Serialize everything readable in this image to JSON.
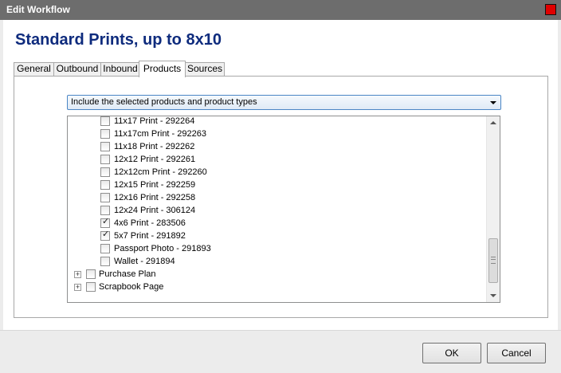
{
  "window": {
    "title": "Edit Workflow"
  },
  "heading": "Standard Prints, up to 8x10",
  "tabs": [
    {
      "label": "General"
    },
    {
      "label": "Outbound"
    },
    {
      "label": "Inbound"
    },
    {
      "label": "Products",
      "active": true
    },
    {
      "label": "Sources"
    }
  ],
  "filter_combo": {
    "value": "Include the selected products and product types"
  },
  "product_tree": {
    "items": [
      {
        "label": "11x17 Print - 292264",
        "checked": false
      },
      {
        "label": "11x17cm Print - 292263",
        "checked": false
      },
      {
        "label": "11x18 Print - 292262",
        "checked": false
      },
      {
        "label": "12x12 Print - 292261",
        "checked": false
      },
      {
        "label": "12x12cm Print - 292260",
        "checked": false
      },
      {
        "label": "12x15 Print - 292259",
        "checked": false
      },
      {
        "label": "12x16 Print - 292258",
        "checked": false
      },
      {
        "label": "12x24 Print - 306124",
        "checked": false
      },
      {
        "label": "4x6 Print - 283506",
        "checked": true
      },
      {
        "label": "5x7 Print - 291892",
        "checked": true
      },
      {
        "label": "Passport Photo - 291893",
        "checked": false
      },
      {
        "label": "Wallet - 291894",
        "checked": false
      }
    ],
    "groups": [
      {
        "label": "Purchase Plan",
        "checked": false,
        "expander": "+"
      },
      {
        "label": "Scrapbook Page",
        "checked": false,
        "expander": "+"
      }
    ],
    "check_glyph": "✓"
  },
  "buttons": {
    "ok": "OK",
    "cancel": "Cancel"
  },
  "colors": {
    "titlebar": "#6d6d6d",
    "close": "#e00000",
    "heading": "#0e2b7d"
  }
}
